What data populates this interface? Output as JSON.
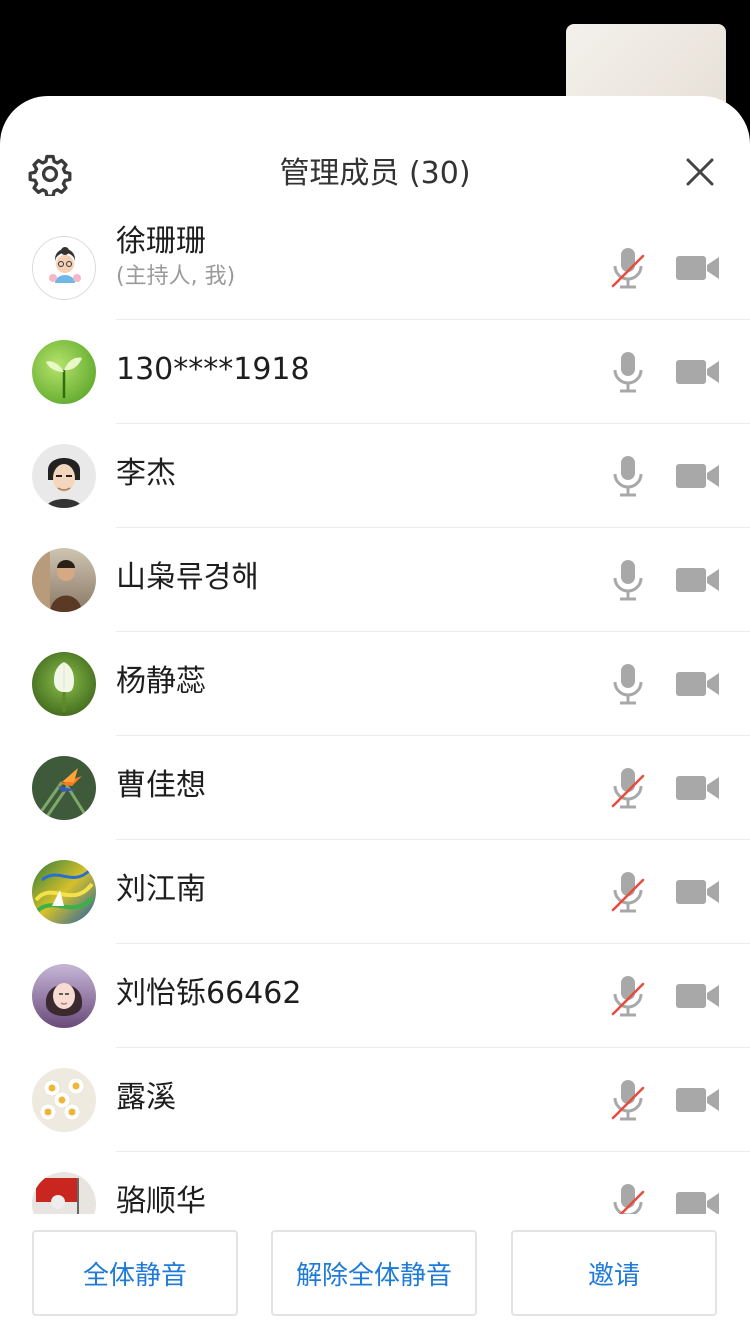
{
  "title": "管理成员 (30)",
  "members": [
    {
      "name": "徐珊珊",
      "role": "(主持人, 我)",
      "muted": true,
      "avatar": "cartoon-girl"
    },
    {
      "name": "130****1918",
      "muted": false,
      "avatar": "green-sprout"
    },
    {
      "name": "李杰",
      "muted": false,
      "avatar": "cartoon-man"
    },
    {
      "name": "山枭류경해",
      "muted": false,
      "avatar": "photo-man"
    },
    {
      "name": "杨静蕊",
      "muted": false,
      "avatar": "white-tulip"
    },
    {
      "name": "曹佳想",
      "muted": true,
      "avatar": "bird-of-paradise"
    },
    {
      "name": "刘江南",
      "muted": true,
      "avatar": "colorful-painting"
    },
    {
      "name": "刘怡铄66462",
      "muted": true,
      "avatar": "girl-portrait"
    },
    {
      "name": "露溪",
      "muted": true,
      "avatar": "chamomile"
    },
    {
      "name": "骆顺华",
      "muted": true,
      "avatar": "red-flag-figure"
    }
  ],
  "footer": {
    "mute_all": "全体静音",
    "unmute_all": "解除全体静音",
    "invite": "邀请"
  },
  "colors": {
    "accent": "#1f7bd8",
    "muted_slash": "#e74c3c",
    "icon_gray": "#a8a8a8"
  }
}
